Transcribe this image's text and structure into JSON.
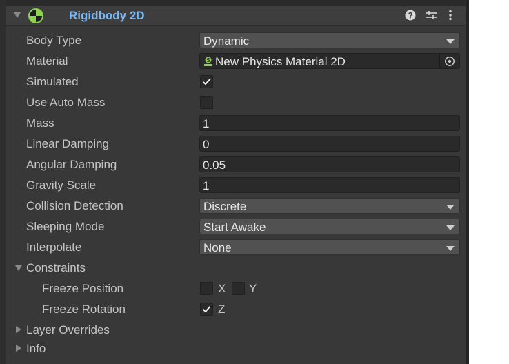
{
  "component": {
    "title": "Rigidbody 2D",
    "icons": [
      "rigidbody-2d-icon",
      "help-icon",
      "presets-icon",
      "more-vertical-icon"
    ]
  },
  "fields": {
    "body_type": {
      "label": "Body Type",
      "value": "Dynamic"
    },
    "material": {
      "label": "Material",
      "value": "New Physics Material 2D"
    },
    "simulated": {
      "label": "Simulated",
      "checked": true
    },
    "use_auto_mass": {
      "label": "Use Auto Mass",
      "checked": false
    },
    "mass": {
      "label": "Mass",
      "value": "1"
    },
    "linear_damping": {
      "label": "Linear Damping",
      "value": "0"
    },
    "angular_damping": {
      "label": "Angular Damping",
      "value": "0.05"
    },
    "gravity_scale": {
      "label": "Gravity Scale",
      "value": "1"
    },
    "collision_detection": {
      "label": "Collision Detection",
      "value": "Discrete"
    },
    "sleeping_mode": {
      "label": "Sleeping Mode",
      "value": "Start Awake"
    },
    "interpolate": {
      "label": "Interpolate",
      "value": "None"
    }
  },
  "constraints": {
    "label": "Constraints",
    "expanded": true,
    "freeze_position": {
      "label": "Freeze Position",
      "x_label": "X",
      "y_label": "Y",
      "x": false,
      "y": false
    },
    "freeze_rotation": {
      "label": "Freeze Rotation",
      "z_label": "Z",
      "z": true
    }
  },
  "sections": {
    "layer_overrides": {
      "label": "Layer Overrides",
      "expanded": false
    },
    "info": {
      "label": "Info",
      "expanded": false
    }
  },
  "colors": {
    "panel_bg": "#383838",
    "title_accent": "#7ab8f5",
    "field_bg": "#2a2a2a",
    "dropdown_bg": "#515151"
  }
}
